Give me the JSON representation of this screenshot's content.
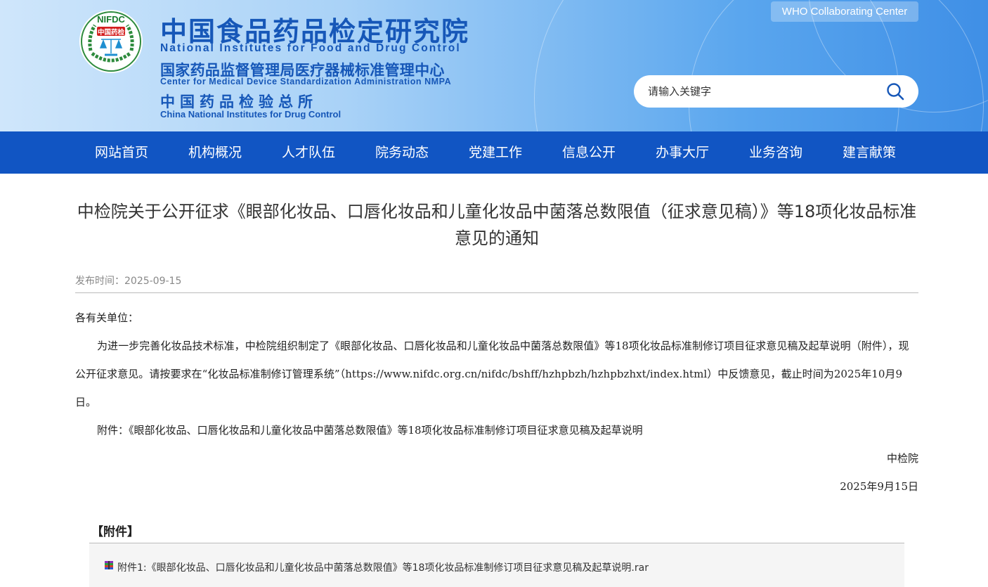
{
  "header": {
    "logo_text": "NIFDC",
    "logo_cn": "中国药检",
    "title_cn": "中国食品药品检定研究院",
    "title_en": "National Institutes for Food and Drug Control",
    "center_cn": "国家药品监督管理局医疗器械标准管理中心",
    "center_en": "Center for Medical Device Standardization Administration NMPA",
    "institute_cn": "中国药品检验总所",
    "institute_en": "China National Institutes for Drug Control",
    "who_link": "WHO Collaborating Center",
    "search_placeholder": "请输入关键字"
  },
  "nav": {
    "items": [
      "网站首页",
      "机构概况",
      "人才队伍",
      "院务动态",
      "党建工作",
      "信息公开",
      "办事大厅",
      "业务咨询",
      "建言献策"
    ]
  },
  "article": {
    "title": "中检院关于公开征求《眼部化妆品、口唇化妆品和儿童化妆品中菌落总数限值（征求意见稿）》等18项化妆品标准意见的通知",
    "publish_label": "发布时间：",
    "publish_date": "2025-09-15",
    "greeting": "各有关单位：",
    "paragraph": "为进一步完善化妆品技术标准，中检院组织制定了《眼部化妆品、口唇化妆品和儿童化妆品中菌落总数限值》等18项化妆品标准制修订项目征求意见稿及起草说明（附件），现公开征求意见。请按要求在“化妆品标准制修订管理系统”（https://www.nifdc.org.cn/nifdc/bshff/hzhpbzh/hzhpbzhxt/index.html）中反馈意见，截止时间为2025年10月9日。",
    "attachment_line": "附件：《眼部化妆品、口唇化妆品和儿童化妆品中菌落总数限值》等18项化妆品标准制修订项目征求意见稿及起草说明",
    "signature": "中检院",
    "sign_date": "2025年9月15日"
  },
  "attachments": {
    "heading": "【附件】",
    "files": [
      "附件1:《眼部化妆品、口唇化妆品和儿童化妆品中菌落总数限值》等18项化妆品标准制修订项目征求意见稿及起草说明.rar"
    ]
  },
  "colors": {
    "brand_blue": "#1657b8",
    "nav_blue": "#1155c3"
  }
}
